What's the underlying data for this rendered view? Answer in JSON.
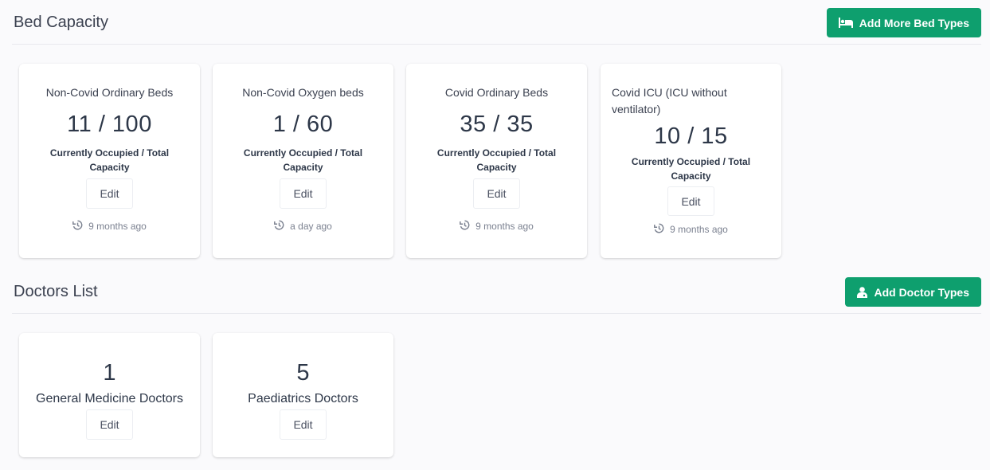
{
  "bed_section": {
    "title": "Bed Capacity",
    "add_button_label": "Add More Bed Types",
    "add_button_icon": "bed-icon",
    "cards": [
      {
        "name": "Non-Covid Ordinary Beds",
        "count": "11 / 100",
        "caption": "Currently Occupied / Total Capacity",
        "edit_label": "Edit",
        "updated": "9 months ago"
      },
      {
        "name": "Non-Covid Oxygen beds",
        "count": "1 / 60",
        "caption": "Currently Occupied / Total Capacity",
        "edit_label": "Edit",
        "updated": "a day ago"
      },
      {
        "name": "Covid Ordinary Beds",
        "count": "35 / 35",
        "caption": "Currently Occupied / Total Capacity",
        "edit_label": "Edit",
        "updated": "9 months ago"
      },
      {
        "name": "Covid ICU (ICU without ventilator)",
        "count": "10 / 15",
        "caption": "Currently Occupied / Total Capacity",
        "edit_label": "Edit",
        "updated": "9 months ago"
      }
    ]
  },
  "doctor_section": {
    "title": "Doctors List",
    "add_button_label": "Add Doctor Types",
    "add_button_icon": "doctor-icon",
    "cards": [
      {
        "count": "1",
        "name": "General Medicine Doctors",
        "edit_label": "Edit"
      },
      {
        "count": "5",
        "name": "Paediatrics Doctors",
        "edit_label": "Edit"
      }
    ]
  },
  "colors": {
    "accent": "#0e9f6e",
    "background": "#fafafc",
    "card": "#ffffff",
    "muted_text": "#7b8190"
  }
}
